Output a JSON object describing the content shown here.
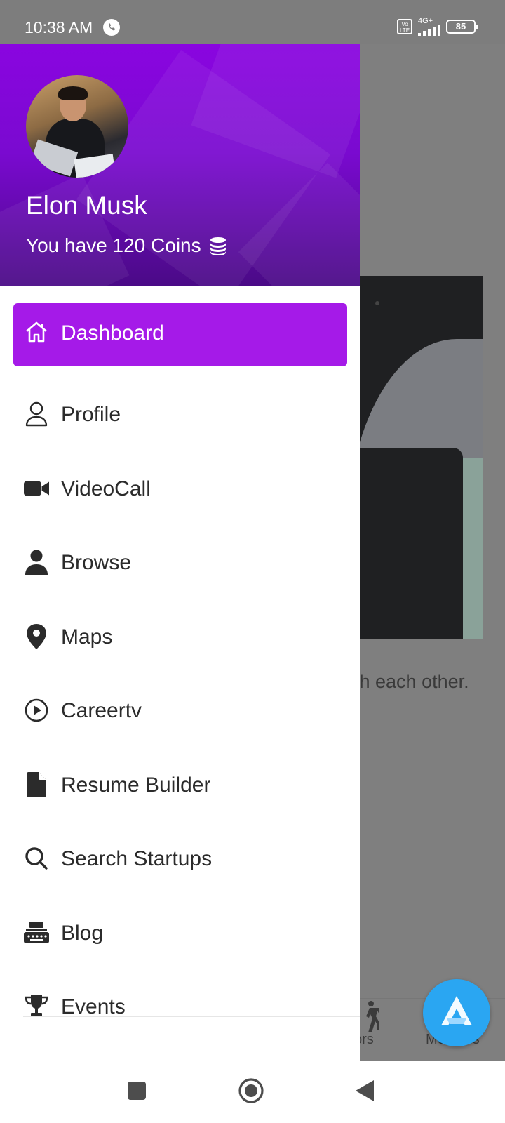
{
  "status_bar": {
    "time": "10:38 AM",
    "network_type": "4G+",
    "volte_label": "Vo LTE",
    "battery_percent": "85",
    "icons": [
      "call-icon",
      "volte-icon",
      "signal-icon",
      "battery-icon"
    ]
  },
  "drawer": {
    "header": {
      "user_name": "Elon Musk",
      "coins_text": "You have 120 Coins",
      "coins_icon": "coins-stack-icon"
    },
    "menu": [
      {
        "label": "Dashboard",
        "icon": "home-icon",
        "active": true
      },
      {
        "label": "Profile",
        "icon": "user-outline-icon"
      },
      {
        "label": "VideoCall",
        "icon": "video-camera-icon"
      },
      {
        "label": "Browse",
        "icon": "user-solid-icon"
      },
      {
        "label": "Maps",
        "icon": "map-pin-icon"
      },
      {
        "label": "Careertv",
        "icon": "play-circle-icon"
      },
      {
        "label": "Resume Builder",
        "icon": "file-icon"
      },
      {
        "label": "Search Startups",
        "icon": "search-icon"
      },
      {
        "label": "Blog",
        "icon": "typewriter-icon"
      },
      {
        "label": "Events",
        "icon": "trophy-icon"
      }
    ],
    "accent_color": "#a51ae8"
  },
  "background_page": {
    "partial_text": "th each other.",
    "bottom_nav": {
      "partial_label": "ors",
      "label": "Mentees"
    },
    "fab_icon": "app-logo-icon"
  },
  "nav_bar": {
    "icons": [
      "recents-square-icon",
      "home-circle-icon",
      "back-triangle-icon"
    ]
  }
}
